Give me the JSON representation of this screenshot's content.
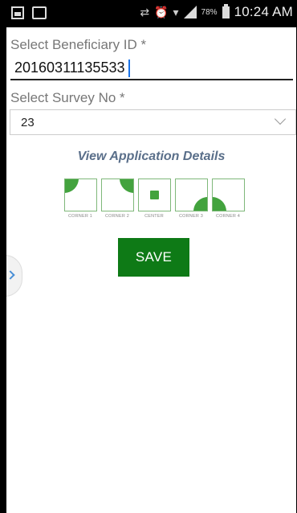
{
  "status_bar": {
    "battery_percent": "78%",
    "time": "10:24 AM"
  },
  "form": {
    "beneficiary_label": "Select Beneficiary ID *",
    "beneficiary_value": "20160311135533",
    "survey_label": "Select Survey No *",
    "survey_value": "23"
  },
  "details_link": "View Application Details",
  "tiles": [
    {
      "label": "CORNER 1"
    },
    {
      "label": "CORNER 2"
    },
    {
      "label": "CENTER"
    },
    {
      "label": "CORNER 3"
    },
    {
      "label": "CORNER 4"
    }
  ],
  "save_label": "SAVE",
  "colors": {
    "accent_green": "#0e7a16",
    "tile_green": "#43a33e",
    "link_blue_gray": "#5a6f8a"
  }
}
